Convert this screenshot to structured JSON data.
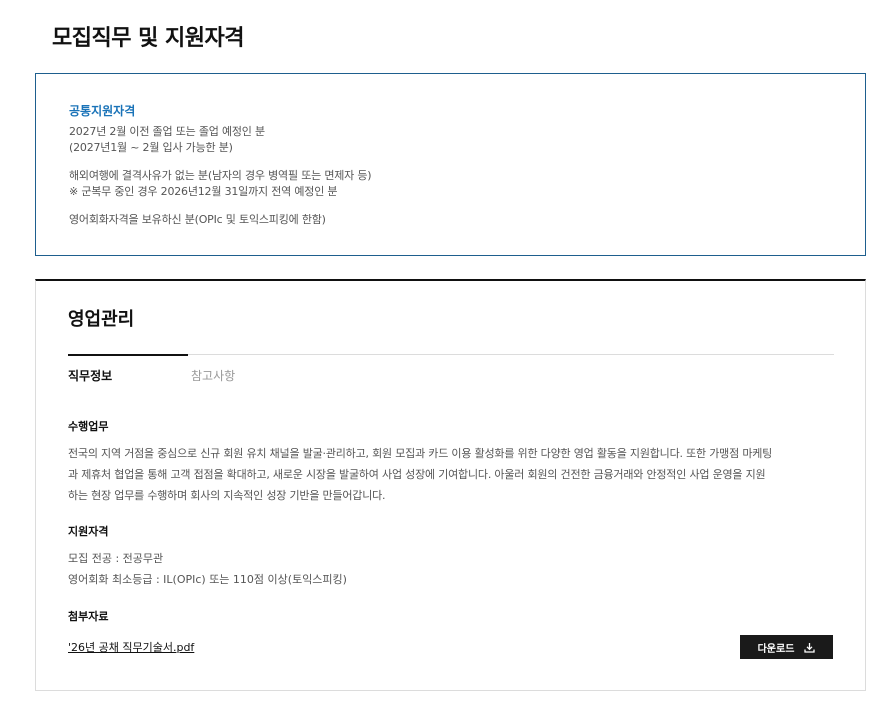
{
  "page_title": "모집직무 및 지원자격",
  "common": {
    "title": "공통지원자격",
    "lines": [
      "2027년 2월 이전 졸업 또는 졸업 예정인 분",
      "(2027년1월 ~ 2월 입사 가능한 분)",
      "",
      "해외여행에 결격사유가 없는 분(남자의 경우 병역필 또는 면제자 등)",
      "※ 군복무 중인 경우 2026년12월 31일까지 전역 예정인 분",
      "",
      "영어회화자격을 보유하신 분(OPIc 및 토익스피킹에 한함)"
    ]
  },
  "job": {
    "title": "영업관리",
    "tabs": [
      {
        "label": "직무정보",
        "active": true
      },
      {
        "label": "참고사항",
        "active": false
      }
    ],
    "duties": {
      "heading": "수행업무",
      "lines": [
        "전국의 지역 거점을 중심으로 신규 회원 유치 채널을 발굴·관리하고, 회원 모집과 카드 이용 활성화를 위한 다양한 영업 활동을 지원합니다. 또한 가맹점 마케팅",
        "과 제휴처 협업을 통해 고객 접점을 확대하고, 새로운 시장을 발굴하여 사업 성장에 기여합니다. 아울러 회원의 건전한 금융거래와 안정적인 사업 운영을 지원",
        "하는 현장 업무를 수행하며 회사의 지속적인 성장 기반을 만들어갑니다."
      ]
    },
    "qualifications": {
      "heading": "지원자격",
      "lines": [
        "모집 전공 : 전공무관",
        "영어회화 최소등급 : IL(OPIc) 또는 110점 이상(토익스피킹)"
      ]
    },
    "attachments": {
      "heading": "첨부자료",
      "file_name": "'26년 공채 직무기술서.pdf",
      "download_label": "다운로드",
      "download_icon": "download-icon"
    }
  }
}
